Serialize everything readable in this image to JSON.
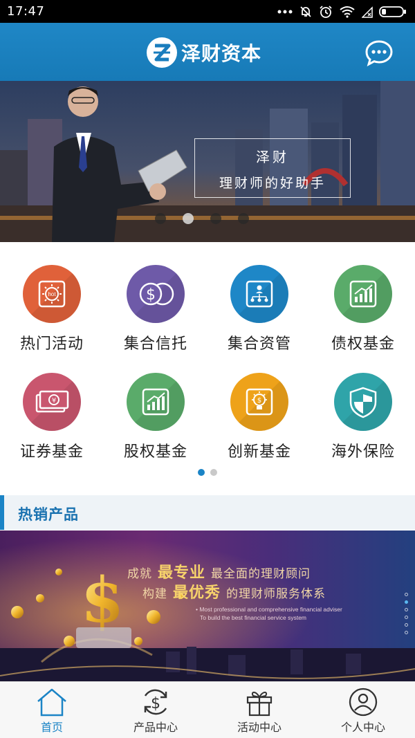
{
  "status_bar": {
    "time": "17:47"
  },
  "header": {
    "brand_name": "泽财资本",
    "logo_glyph": "Z"
  },
  "banner": {
    "slogan_title": "泽财",
    "slogan_subtitle": "理财师的好助手",
    "slide_count": 4,
    "active_slide": 2
  },
  "categories": [
    {
      "label": "热门活动",
      "icon": "hot-activity-icon",
      "color": "#e0613a"
    },
    {
      "label": "集合信托",
      "icon": "coins-icon",
      "color": "#6e5aa8"
    },
    {
      "label": "集合资管",
      "icon": "org-chart-icon",
      "color": "#1e87c7"
    },
    {
      "label": "债权基金",
      "icon": "growth-chart-icon",
      "color": "#5aab6a"
    },
    {
      "label": "证券基金",
      "icon": "banknote-icon",
      "color": "#c9566e"
    },
    {
      "label": "股权基金",
      "icon": "bar-chart-icon",
      "color": "#5aab6a"
    },
    {
      "label": "创新基金",
      "icon": "idea-bulb-icon",
      "color": "#eea21a"
    },
    {
      "label": "海外保险",
      "icon": "shield-icon",
      "color": "#2fa4a9"
    }
  ],
  "grid_pager": {
    "pages": 2,
    "active": 1
  },
  "section": {
    "title": "热销产品"
  },
  "product_banner": {
    "line1_prefix": "成就",
    "line1_emphasis": "最专业",
    "line1_suffix": "最全面的理财顾问",
    "line2_prefix": "构建",
    "line2_emphasis": "最优秀",
    "line2_suffix": "的理财师服务体系",
    "english_line1": "• Most professional and comprehensive financial adviser",
    "english_line2": "To build the best financial service system",
    "slide_count": 6,
    "active_slide": 2
  },
  "tabs": [
    {
      "label": "首页",
      "icon": "home-icon",
      "active": true
    },
    {
      "label": "产品中心",
      "icon": "dollar-refresh-icon",
      "active": false
    },
    {
      "label": "活动中心",
      "icon": "gift-icon",
      "active": false
    },
    {
      "label": "个人中心",
      "icon": "user-icon",
      "active": false
    }
  ],
  "colors": {
    "primary": "#1b84c6",
    "header": "#1f87c6",
    "section_bg": "#eef3f7"
  }
}
